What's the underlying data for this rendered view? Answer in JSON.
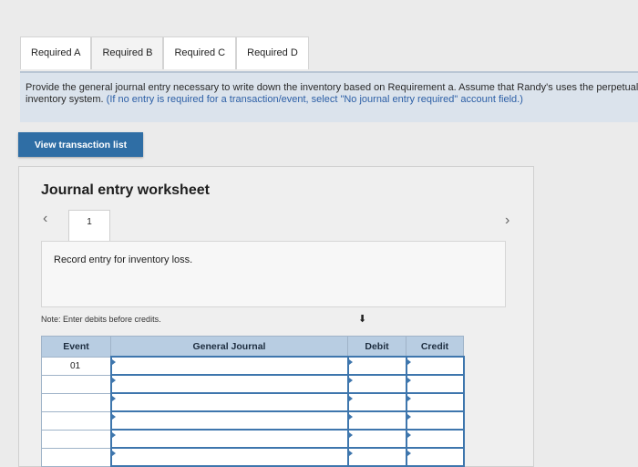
{
  "tabs": [
    {
      "label": "Required A"
    },
    {
      "label": "Required B"
    },
    {
      "label": "Required C"
    },
    {
      "label": "Required D"
    }
  ],
  "instructions": {
    "text": "Provide the general journal entry necessary to write down the inventory based on Requirement a. Assume that Randy's uses the perpetual inventory system.",
    "hint": "(If no entry is required for a transaction/event, select \"No journal entry required\" account field.)"
  },
  "view_button": {
    "label": "View transaction list"
  },
  "worksheet": {
    "title": "Journal entry worksheet",
    "page_number": "1",
    "entry_prompt": "Record entry for inventory loss.",
    "note": "Note: Enter debits before credits.",
    "columns": {
      "event": "Event",
      "general_journal": "General Journal",
      "debit": "Debit",
      "credit": "Credit"
    },
    "rows": [
      {
        "event": "01"
      },
      {
        "event": ""
      },
      {
        "event": ""
      },
      {
        "event": ""
      },
      {
        "event": ""
      },
      {
        "event": ""
      }
    ]
  },
  "icons": {
    "prev": "chevron-left-icon",
    "next": "chevron-right-icon",
    "cursor": "mouse-cursor-icon"
  }
}
